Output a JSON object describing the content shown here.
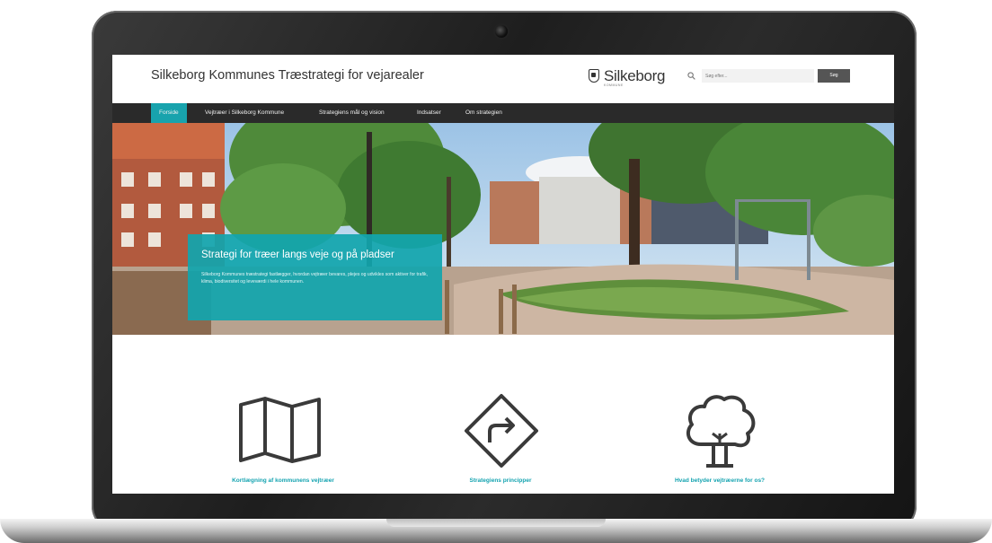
{
  "site": {
    "title": "Silkeborg Kommunes Træstrategi for vejarealer",
    "logo_text": "Silkeborg",
    "logo_subtext": "KOMMUNE",
    "search_placeholder": "Søg efter...",
    "search_button": "Søg"
  },
  "nav": {
    "items": [
      {
        "label": "Forside",
        "active": true
      },
      {
        "label": "Vejtræer i Silkeborg Kommune"
      },
      {
        "label": "Strategiens mål og vision"
      },
      {
        "label": "Indsatser"
      },
      {
        "label": "Om strategien"
      }
    ]
  },
  "hero": {
    "title": "Strategi for træer langs veje og på pladser",
    "text": "Silkeborg Kommunes træstrategi fastlægger, hvordan vejtræer bevares, plejes og udvikles som aktiver for trafik, klima, biodiversitet og leveværdi i hele kommunen."
  },
  "features": [
    {
      "label": "Kortlægning af kommunens vejtræer",
      "icon": "map-icon"
    },
    {
      "label": "Strategiens principper",
      "icon": "road-sign-turn-icon"
    },
    {
      "label": "Hvad betyder vejtræerne for os?",
      "icon": "tree-icon"
    }
  ],
  "colors": {
    "accent": "#18a3ad",
    "nav_bg": "#2a2a2a",
    "feature_label": "#14a3b0"
  }
}
